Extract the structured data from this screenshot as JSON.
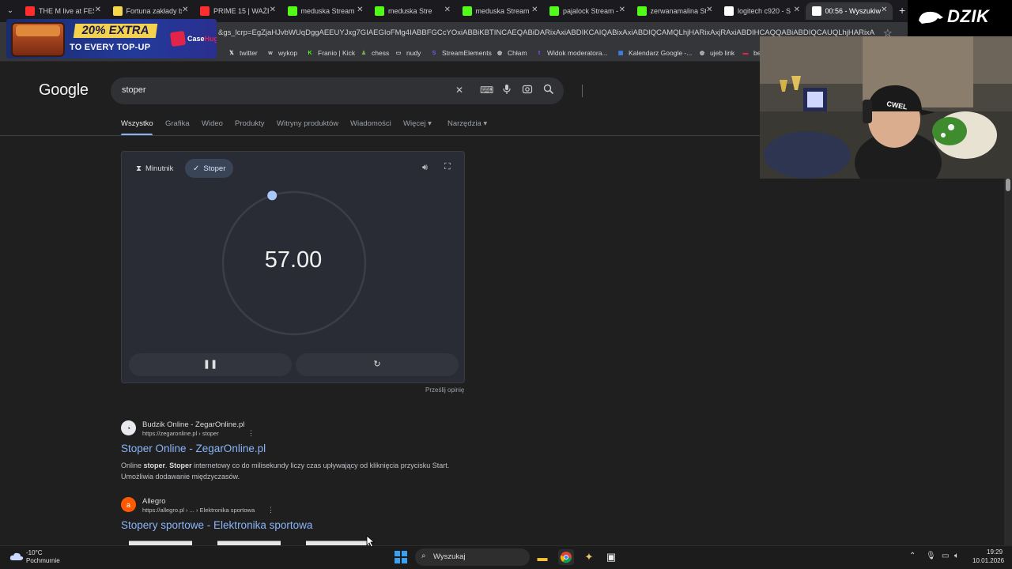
{
  "browser": {
    "tabs": [
      {
        "title": "THE M live at FES",
        "color": "#ff2d2d"
      },
      {
        "title": "Fortuna zakłady b",
        "color": "#f5d94b"
      },
      {
        "title": "PRIME 15 | WAŻE",
        "color": "#ff2d2d"
      },
      {
        "title": "meduska Stream",
        "color": "#53fc18"
      },
      {
        "title": "meduska Stre",
        "color": "#53fc18"
      },
      {
        "title": "meduska Stream",
        "color": "#53fc18"
      },
      {
        "title": "pajalock Stream -",
        "color": "#53fc18"
      },
      {
        "title": "zerwanamalina St",
        "color": "#53fc18"
      },
      {
        "title": "logitech c920 - S",
        "color": "#ffffff"
      },
      {
        "title": "00:56 - Wyszukiw",
        "color": "#ffffff"
      }
    ],
    "url": "&gs_lcrp=EgZjaHJvbWUqDggAEEUYJxg7GIAEGIoFMg4IABBFGCcYOxiABBiKBTINCAEQABiDARixAxiABDIKCAIQABixAxiABDIQCAMQLhjHARixAxjRAxiABDIHCAQQABiABDIQCAUQLhjHARixAxjRAxiABDIGCAcQ...",
    "bookmarks": [
      {
        "label": "twitter",
        "icon": "x-icon",
        "color": "#ffffff"
      },
      {
        "label": "wykop",
        "icon": "wykop-icon",
        "color": "#cfcfcf"
      },
      {
        "label": "Franio | Kick",
        "icon": "kick-icon",
        "color": "#53fc18"
      },
      {
        "label": "chess",
        "icon": "chess-icon",
        "color": "#7fa650"
      },
      {
        "label": "nudy",
        "icon": "folder-icon",
        "color": "#cfcfcf"
      },
      {
        "label": "StreamElements",
        "icon": "streamelements-icon",
        "color": "#6c5cff"
      },
      {
        "label": "Chłam",
        "icon": "globe-icon",
        "color": "#cfcfcf"
      },
      {
        "label": "Widok moderatora...",
        "icon": "twitch-icon",
        "color": "#9146ff"
      },
      {
        "label": "Kalendarz Google -...",
        "icon": "calendar-icon",
        "color": "#4285f4"
      },
      {
        "label": "ujeb link",
        "icon": "globe-icon",
        "color": "#cfcfcf"
      },
      {
        "label": "be",
        "icon": "red-icon",
        "color": "#e0244a"
      }
    ]
  },
  "promo": {
    "line1": "20% EXTRA",
    "line2": "TO EVERY TOP-UP",
    "brand_a": "Case",
    "brand_b": "Hug"
  },
  "google": {
    "logo": "Google",
    "query": "stoper",
    "tabs": [
      "Wszystko",
      "Grafika",
      "Wideo",
      "Produkty",
      "Witryny produktów",
      "Wiadomości",
      "Więcej",
      "Narzędzia"
    ]
  },
  "stopwatch": {
    "mode_timer": "Minutnik",
    "mode_stopwatch": "Stoper",
    "time": "57.00",
    "progress_fraction": 0.95,
    "feedback": "Prześlij opinię"
  },
  "results": [
    {
      "site": "Budzik Online - ZegarOnline.pl",
      "url": "https://zegaronline.pl › stoper",
      "title": "Stoper Online - ZegarOnline.pl",
      "snippet_parts": [
        {
          "t": "Online ",
          "b": false
        },
        {
          "t": "stoper",
          "b": true
        },
        {
          "t": ". ",
          "b": false
        },
        {
          "t": "Stoper",
          "b": true
        },
        {
          "t": " internetowy co do milisekundy liczy czas upływający od kliknięcia przycisku Start. Umożliwia dodawanie międzyczasów.",
          "b": false
        }
      ]
    },
    {
      "site": "Allegro",
      "url": "https://allegro.pl › ... › Elektronika sportowa",
      "title": "Stopery sportowe - Elektronika sportowa"
    }
  ],
  "stream": {
    "brand": "DZIK",
    "cap_text": "CWEL"
  },
  "taskbar": {
    "temp": "-10°C",
    "condition": "Pochmurnie",
    "search": "Wyszukaj",
    "time": "19:29",
    "date": "10.01.2026"
  }
}
